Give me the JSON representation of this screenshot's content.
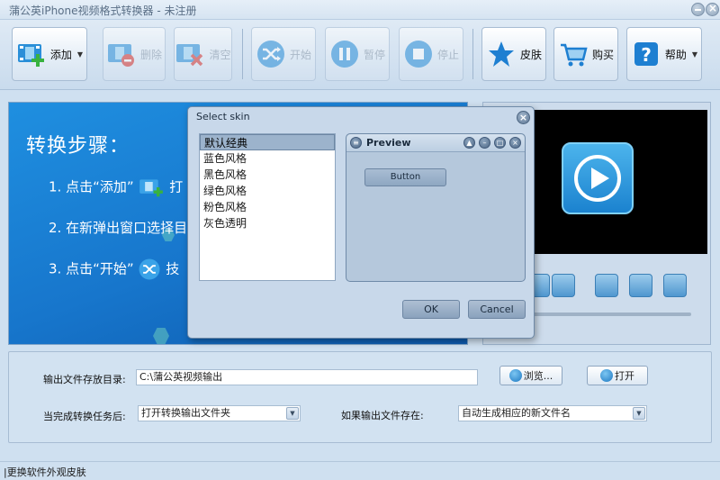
{
  "window": {
    "title": "蒲公英iPhone视频格式转换器 - 未注册"
  },
  "toolbar": {
    "add": "添加",
    "delete": "删除",
    "clear": "清空",
    "start": "开始",
    "pause": "暂停",
    "stop": "停止",
    "skin": "皮肤",
    "buy": "购买",
    "help": "帮助"
  },
  "guide": {
    "title": "转换步骤：",
    "step1": "1. 点击“添加”",
    "step2": "2. 在新弹出窗口选择目",
    "step3": "3. 点击“开始”",
    "step1_tail": "打",
    "step3_tail": "技"
  },
  "skin_dialog": {
    "title": "Select skin",
    "skins": [
      "默认经典",
      "蓝色风格",
      "黑色风格",
      "绿色风格",
      "粉色风格",
      "灰色透明"
    ],
    "selected_index": 0,
    "preview_title": "Preview",
    "preview_button": "Button",
    "ok": "OK",
    "cancel": "Cancel"
  },
  "options": {
    "output_dir_label": "输出文件存放目录:",
    "output_dir_value": "C:\\蒲公英视频输出",
    "browse": "浏览...",
    "open": "打开",
    "after_complete_label": "当完成转换任务后:",
    "after_complete_value": "打开转换输出文件夹",
    "if_exists_label": "如果输出文件存在:",
    "if_exists_value": "自动生成相应的新文件名"
  },
  "statusbar": {
    "text": "|更换软件外观皮肤"
  },
  "colors": {
    "accent": "#1776cc",
    "panel": "#d2e2f1"
  }
}
